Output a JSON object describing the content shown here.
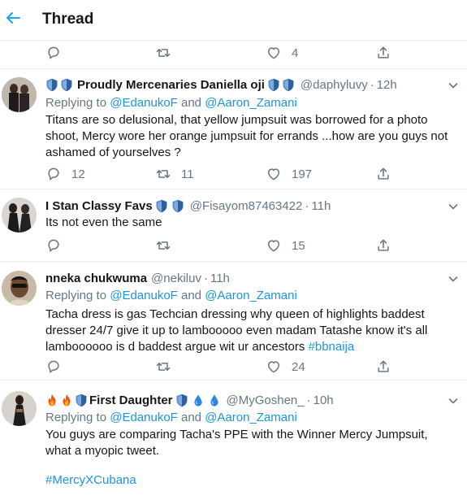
{
  "header": {
    "title": "Thread"
  },
  "top_actions": {
    "reply": "",
    "retweet": "",
    "like": "4"
  },
  "tweets": [
    {
      "name": "Proudly Mercenaries Daniella oji",
      "handle": "@daphyluvy",
      "time": "12h",
      "replying_prefix": "Replying to",
      "mention1": "@EdanukoF",
      "conj": "and",
      "mention2": "@Aaron_Zamani",
      "text": "Titans are so delusional, that yellow jumpsuit was borrowed for a photo shoot, Mercy wore her orange jumpsuit for errands ...how are you guys not ashamed of yourselves ?",
      "replies": "12",
      "retweets": "11",
      "likes": "197"
    },
    {
      "name": "I Stan Classy Favs",
      "handle": "@Fisayom87463422",
      "time": "11h",
      "text": "Its not even the same",
      "replies": "",
      "retweets": "",
      "likes": "15"
    },
    {
      "name": "nneka chukwuma",
      "handle": "@nekiluv",
      "time": "11h",
      "replying_prefix": "Replying to",
      "mention1": "@EdanukoF",
      "conj": "and",
      "mention2": "@Aaron_Zamani",
      "text": "Tacha dress is gas Techcian dressing why queen of highlights baddest dresser 24/7 give it up to lambooooo even madam Tatashe know it's all lamboooooo is d baddest argue wit ur ancestors",
      "hashtag": "#bbnaija",
      "replies": "",
      "retweets": "",
      "likes": "24"
    },
    {
      "name": "First Daughter",
      "handle": "@MyGoshen_",
      "time": "10h",
      "replying_prefix": "Replying to",
      "mention1": "@EdanukoF",
      "conj": "and",
      "mention2": "@Aaron_Zamani",
      "text": "You guys are comparing Tacha's  PPE with the Winner Mercy Jumpsuit, what a myopic tweet.",
      "hashtag": "#MercyXCubana"
    }
  ],
  "colors": {
    "link": "#1b95e0",
    "muted": "#657786",
    "text": "#14171a",
    "divider": "#e6ecf0",
    "badge": "#2f5f9e"
  }
}
